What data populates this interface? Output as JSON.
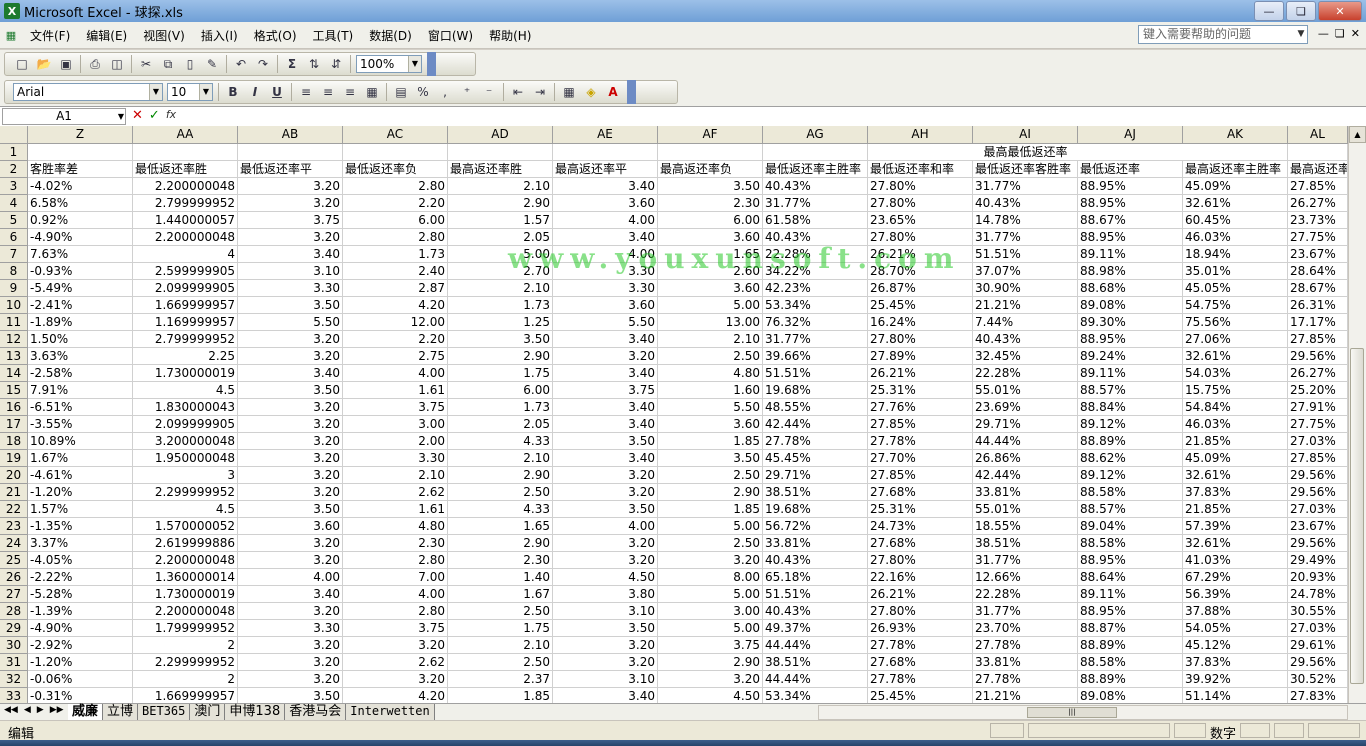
{
  "window": {
    "title": "Microsoft Excel - 球探.xls",
    "app_icon": "excel-icon"
  },
  "menu": [
    "文件(F)",
    "编辑(E)",
    "视图(V)",
    "插入(I)",
    "格式(O)",
    "工具(T)",
    "数据(D)",
    "窗口(W)",
    "帮助(H)"
  ],
  "help_search": {
    "placeholder": "键入需要帮助的问题"
  },
  "toolbar": {
    "zoom": "100%",
    "font_name": "Arial",
    "font_size": "10",
    "bold": "B",
    "italic": "I",
    "underline": "U",
    "sigma": "Σ",
    "percent": "%"
  },
  "namebox": {
    "value": "A1"
  },
  "grid": {
    "columns": [
      "Z",
      "AA",
      "AB",
      "AC",
      "AD",
      "AE",
      "AF",
      "AG",
      "AH",
      "AI",
      "AJ",
      "AK",
      "AL"
    ],
    "row1_merged": "最高最低返还率",
    "headers": [
      "客胜率差",
      "最低返还率胜",
      "最低返还率平",
      "最低返还率负",
      "最高返还率胜",
      "最高返还率平",
      "最高返还率负",
      "最低返还率主胜率",
      "最低返还率和率",
      "最低返还率客胜率",
      "最低返还率",
      "最高返还率主胜率",
      "最高返还率"
    ],
    "rows": [
      [
        "-4.02%",
        "2.200000048",
        "3.20",
        "2.80",
        "2.10",
        "3.40",
        "3.50",
        "40.43%",
        "27.80%",
        "31.77%",
        "88.95%",
        "45.09%",
        "27.85%"
      ],
      [
        "6.58%",
        "2.799999952",
        "3.20",
        "2.20",
        "2.90",
        "3.60",
        "2.30",
        "31.77%",
        "27.80%",
        "40.43%",
        "88.95%",
        "32.61%",
        "26.27%"
      ],
      [
        "0.92%",
        "1.440000057",
        "3.75",
        "6.00",
        "1.57",
        "4.00",
        "6.00",
        "61.58%",
        "23.65%",
        "14.78%",
        "88.67%",
        "60.45%",
        "23.73%"
      ],
      [
        "-4.90%",
        "2.200000048",
        "3.20",
        "2.80",
        "2.05",
        "3.40",
        "3.60",
        "40.43%",
        "27.80%",
        "31.77%",
        "88.95%",
        "46.03%",
        "27.75%"
      ],
      [
        "7.63%",
        "4",
        "3.40",
        "1.73",
        "5.00",
        "4.00",
        "1.65",
        "22.28%",
        "26.21%",
        "51.51%",
        "89.11%",
        "18.94%",
        "23.67%"
      ],
      [
        "-0.93%",
        "2.599999905",
        "3.10",
        "2.40",
        "2.70",
        "3.30",
        "2.60",
        "34.22%",
        "28.70%",
        "37.07%",
        "88.98%",
        "35.01%",
        "28.64%"
      ],
      [
        "-5.49%",
        "2.099999905",
        "3.30",
        "2.87",
        "2.10",
        "3.30",
        "3.60",
        "42.23%",
        "26.87%",
        "30.90%",
        "88.68%",
        "45.05%",
        "28.67%"
      ],
      [
        "-2.41%",
        "1.669999957",
        "3.50",
        "4.20",
        "1.73",
        "3.60",
        "5.00",
        "53.34%",
        "25.45%",
        "21.21%",
        "89.08%",
        "54.75%",
        "26.31%"
      ],
      [
        "-1.89%",
        "1.169999957",
        "5.50",
        "12.00",
        "1.25",
        "5.50",
        "13.00",
        "76.32%",
        "16.24%",
        "7.44%",
        "89.30%",
        "75.56%",
        "17.17%"
      ],
      [
        "1.50%",
        "2.799999952",
        "3.20",
        "2.20",
        "3.50",
        "3.40",
        "2.10",
        "31.77%",
        "27.80%",
        "40.43%",
        "88.95%",
        "27.06%",
        "27.85%"
      ],
      [
        "3.63%",
        "2.25",
        "3.20",
        "2.75",
        "2.90",
        "3.20",
        "2.50",
        "39.66%",
        "27.89%",
        "32.45%",
        "89.24%",
        "32.61%",
        "29.56%"
      ],
      [
        "-2.58%",
        "1.730000019",
        "3.40",
        "4.00",
        "1.75",
        "3.40",
        "4.80",
        "51.51%",
        "26.21%",
        "22.28%",
        "89.11%",
        "54.03%",
        "26.27%"
      ],
      [
        "7.91%",
        "4.5",
        "3.50",
        "1.61",
        "6.00",
        "3.75",
        "1.60",
        "19.68%",
        "25.31%",
        "55.01%",
        "88.57%",
        "15.75%",
        "25.20%"
      ],
      [
        "-6.51%",
        "1.830000043",
        "3.20",
        "3.75",
        "1.73",
        "3.40",
        "5.50",
        "48.55%",
        "27.76%",
        "23.69%",
        "88.84%",
        "54.84%",
        "27.91%"
      ],
      [
        "-3.55%",
        "2.099999905",
        "3.20",
        "3.00",
        "2.05",
        "3.40",
        "3.60",
        "42.44%",
        "27.85%",
        "29.71%",
        "89.12%",
        "46.03%",
        "27.75%"
      ],
      [
        "10.89%",
        "3.200000048",
        "3.20",
        "2.00",
        "4.33",
        "3.50",
        "1.85",
        "27.78%",
        "27.78%",
        "44.44%",
        "88.89%",
        "21.85%",
        "27.03%"
      ],
      [
        "1.67%",
        "1.950000048",
        "3.20",
        "3.30",
        "2.10",
        "3.40",
        "3.50",
        "45.45%",
        "27.70%",
        "26.86%",
        "88.62%",
        "45.09%",
        "27.85%"
      ],
      [
        "-4.61%",
        "3",
        "3.20",
        "2.10",
        "2.90",
        "3.20",
        "2.50",
        "29.71%",
        "27.85%",
        "42.44%",
        "89.12%",
        "32.61%",
        "29.56%"
      ],
      [
        "-1.20%",
        "2.299999952",
        "3.20",
        "2.62",
        "2.50",
        "3.20",
        "2.90",
        "38.51%",
        "27.68%",
        "33.81%",
        "88.58%",
        "37.83%",
        "29.56%"
      ],
      [
        "1.57%",
        "4.5",
        "3.50",
        "1.61",
        "4.33",
        "3.50",
        "1.85",
        "19.68%",
        "25.31%",
        "55.01%",
        "88.57%",
        "21.85%",
        "27.03%"
      ],
      [
        "-1.35%",
        "1.570000052",
        "3.60",
        "4.80",
        "1.65",
        "4.00",
        "5.00",
        "56.72%",
        "24.73%",
        "18.55%",
        "89.04%",
        "57.39%",
        "23.67%"
      ],
      [
        "3.37%",
        "2.619999886",
        "3.20",
        "2.30",
        "2.90",
        "3.20",
        "2.50",
        "33.81%",
        "27.68%",
        "38.51%",
        "88.58%",
        "32.61%",
        "29.56%"
      ],
      [
        "-4.05%",
        "2.200000048",
        "3.20",
        "2.80",
        "2.30",
        "3.20",
        "3.20",
        "40.43%",
        "27.80%",
        "31.77%",
        "88.95%",
        "41.03%",
        "29.49%"
      ],
      [
        "-2.22%",
        "1.360000014",
        "4.00",
        "7.00",
        "1.40",
        "4.50",
        "8.00",
        "65.18%",
        "22.16%",
        "12.66%",
        "88.64%",
        "67.29%",
        "20.93%"
      ],
      [
        "-5.28%",
        "1.730000019",
        "3.40",
        "4.00",
        "1.67",
        "3.80",
        "5.00",
        "51.51%",
        "26.21%",
        "22.28%",
        "89.11%",
        "56.39%",
        "24.78%"
      ],
      [
        "-1.39%",
        "2.200000048",
        "3.20",
        "2.80",
        "2.50",
        "3.10",
        "3.00",
        "40.43%",
        "27.80%",
        "31.77%",
        "88.95%",
        "37.88%",
        "30.55%"
      ],
      [
        "-4.90%",
        "1.799999952",
        "3.30",
        "3.75",
        "1.75",
        "3.50",
        "5.00",
        "49.37%",
        "26.93%",
        "23.70%",
        "88.87%",
        "54.05%",
        "27.03%"
      ],
      [
        "-2.92%",
        "2",
        "3.20",
        "3.20",
        "2.10",
        "3.20",
        "3.75",
        "44.44%",
        "27.78%",
        "27.78%",
        "88.89%",
        "45.12%",
        "29.61%"
      ],
      [
        "-1.20%",
        "2.299999952",
        "3.20",
        "2.62",
        "2.50",
        "3.20",
        "2.90",
        "38.51%",
        "27.68%",
        "33.81%",
        "88.58%",
        "37.83%",
        "29.56%"
      ],
      [
        "-0.06%",
        "2",
        "3.20",
        "3.20",
        "2.37",
        "3.10",
        "3.20",
        "44.44%",
        "27.78%",
        "27.78%",
        "88.89%",
        "39.92%",
        "30.52%"
      ],
      [
        "-0.31%",
        "1.669999957",
        "3.50",
        "4.20",
        "1.85",
        "3.40",
        "4.50",
        "53.34%",
        "25.45%",
        "21.21%",
        "89.08%",
        "51.14%",
        "27.83%"
      ]
    ]
  },
  "watermark": "www.youxunsoft.com",
  "sheets": [
    "威廉",
    "立博",
    "BET365",
    "澳门",
    "申博138",
    "香港马会",
    "Interwetten"
  ],
  "active_sheet": "威廉",
  "status": {
    "mode": "编辑",
    "numlock": "数字"
  }
}
